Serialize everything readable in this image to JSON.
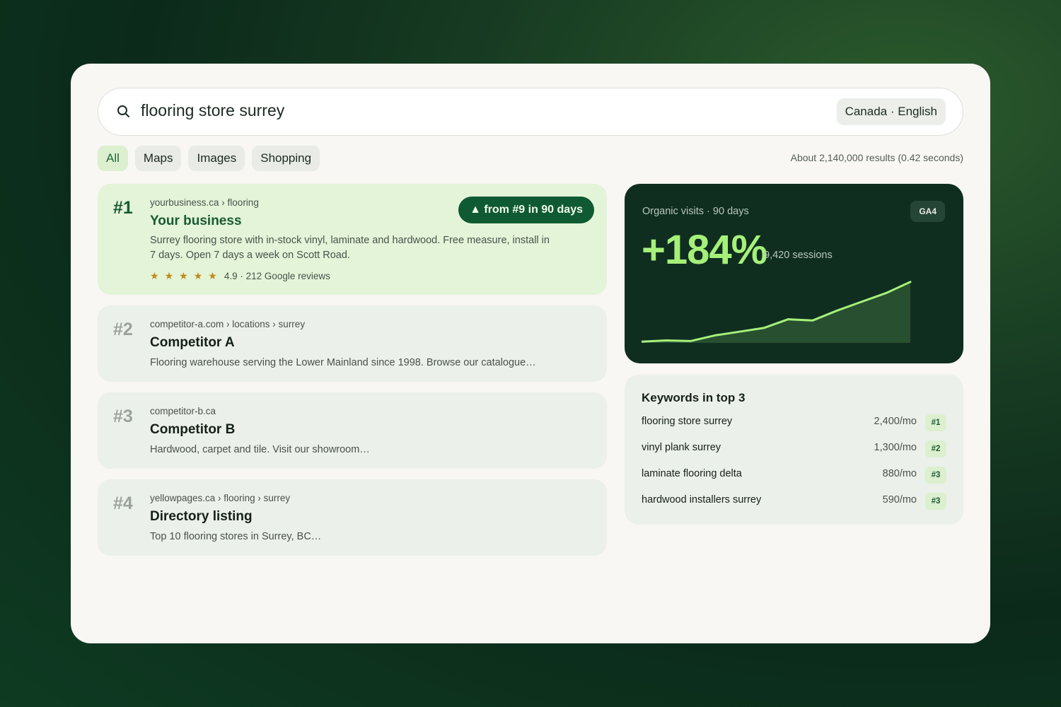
{
  "search": {
    "query": "flooring store surrey",
    "region": "Canada · English"
  },
  "tabs": [
    {
      "label": "All",
      "active": true
    },
    {
      "label": "Maps",
      "active": false
    },
    {
      "label": "Images",
      "active": false
    },
    {
      "label": "Shopping",
      "active": false
    }
  ],
  "results_count": "About 2,140,000 results (0.42 seconds)",
  "results": [
    {
      "rank": "#1",
      "breadcrumb": "yourbusiness.ca › flooring",
      "title": "Your business",
      "description": "Surrey flooring store with in-stock vinyl, laminate and hardwood. Free measure, install in 7 days. Open 7 days a week on Scott Road.",
      "rating_text": "4.9 · 212 Google reviews",
      "star_count": 5,
      "movement": "▲ from #9 in 90 days"
    },
    {
      "rank": "#2",
      "breadcrumb": "competitor-a.com › locations › surrey",
      "title": "Competitor A",
      "description": "Flooring warehouse serving the Lower Mainland since 1998. Browse our catalogue…"
    },
    {
      "rank": "#3",
      "breadcrumb": "competitor-b.ca",
      "title": "Competitor B",
      "description": "Hardwood, carpet and tile. Visit our showroom…"
    },
    {
      "rank": "#4",
      "breadcrumb": "yellowpages.ca › flooring › surrey",
      "title": "Directory listing",
      "description": "Top 10 flooring stores in Surrey, BC…"
    }
  ],
  "analytics": {
    "label": "Organic visits · 90 days",
    "badge": "GA4",
    "change": "+184%",
    "sessions": "9,420 sessions",
    "line_color": "#a6f07a",
    "area_color": "#284f30"
  },
  "chart_data": {
    "type": "area",
    "x": [
      0,
      1,
      2,
      3,
      4,
      5,
      6,
      7,
      8,
      9,
      10,
      11
    ],
    "values": [
      1,
      2,
      1.5,
      6,
      9,
      12,
      19,
      18,
      26,
      33,
      40,
      49
    ],
    "ylim": [
      0,
      54
    ],
    "title": "",
    "xlabel": "",
    "ylabel": ""
  },
  "keywords": {
    "title": "Keywords in top 3",
    "rows": [
      {
        "term": "flooring store surrey",
        "volume": "2,400/mo",
        "position": "#1"
      },
      {
        "term": "vinyl plank surrey",
        "volume": "1,300/mo",
        "position": "#2"
      },
      {
        "term": "laminate flooring delta",
        "volume": "880/mo",
        "position": "#3"
      },
      {
        "term": "hardwood installers surrey",
        "volume": "590/mo",
        "position": "#3"
      }
    ]
  }
}
